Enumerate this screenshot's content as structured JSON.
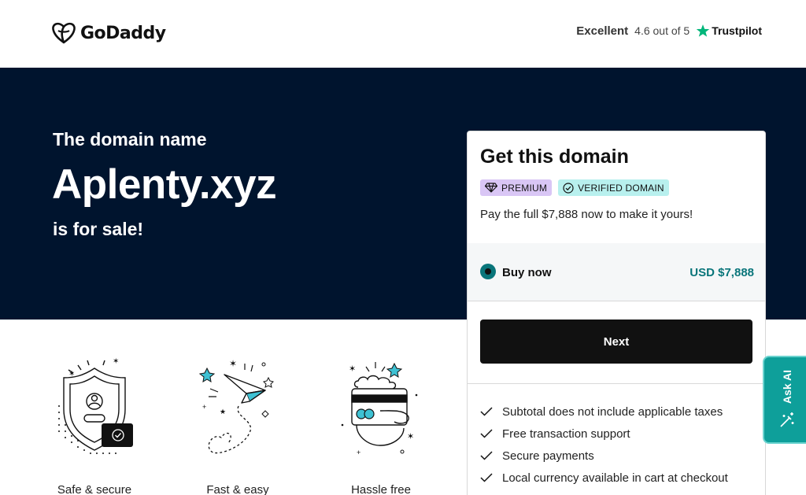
{
  "header": {
    "brand": "GoDaddy",
    "rating": {
      "label": "Excellent",
      "score": "4.6 out of 5",
      "provider": "Trustpilot",
      "star_color": "#00b67a"
    }
  },
  "hero": {
    "pre": "The domain name",
    "domain": "Aplenty.xyz",
    "post": "is for sale!",
    "background": "#00142e"
  },
  "card": {
    "title": "Get this domain",
    "badges": {
      "premium": "PREMIUM",
      "verified": "VERIFIED DOMAIN"
    },
    "description": "Pay the full $7,888 now to make it yours!",
    "option": {
      "label": "Buy now",
      "price": "USD $7,888",
      "selected": true
    },
    "next_label": "Next",
    "features": [
      "Subtotal does not include applicable taxes",
      "Free transaction support",
      "Secure payments",
      "Local currency available in cart at checkout"
    ],
    "accent": "#09757a"
  },
  "benefits": [
    {
      "label": "Safe & secure",
      "icon": "shield-icon"
    },
    {
      "label": "Fast & easy",
      "icon": "paper-plane-icon"
    },
    {
      "label": "Hassle free",
      "icon": "card-hand-icon"
    }
  ],
  "ask_ai": {
    "label": "Ask AI",
    "color": "#0e9f9a"
  }
}
